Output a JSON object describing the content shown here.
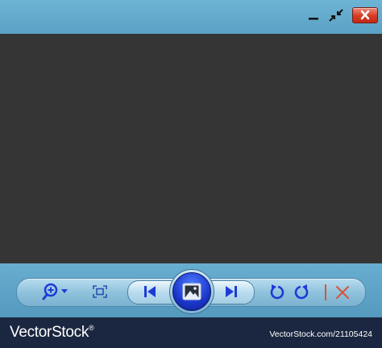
{
  "window": {
    "buttons": {
      "minimize_icon": "minimize-icon",
      "restore_icon": "restore-icon",
      "close_icon": "close-icon"
    }
  },
  "toolbar": {
    "controls": [
      {
        "name": "zoom",
        "icon": "zoom-in-icon",
        "has_dropdown": true
      },
      {
        "name": "fit-to-window",
        "icon": "fit-to-window-icon"
      },
      {
        "name": "previous",
        "icon": "skip-previous-icon"
      },
      {
        "name": "slideshow",
        "icon": "slideshow-icon"
      },
      {
        "name": "next",
        "icon": "skip-next-icon"
      },
      {
        "name": "rotate-counterclockwise",
        "icon": "rotate-ccw-icon"
      },
      {
        "name": "rotate-clockwise",
        "icon": "rotate-cw-icon"
      },
      {
        "name": "delete",
        "icon": "delete-icon"
      }
    ]
  },
  "colors": {
    "window_frame": "#5fa6c9",
    "viewer_background": "#353535",
    "icon_blue": "#1f3ad6",
    "close_red": "#d43a24",
    "delete_red": "#d8543a",
    "watermark_bar": "#1b2740"
  },
  "watermark": {
    "brand": "VectorStock",
    "registered": "®",
    "url": "VectorStock.com/21105424"
  }
}
